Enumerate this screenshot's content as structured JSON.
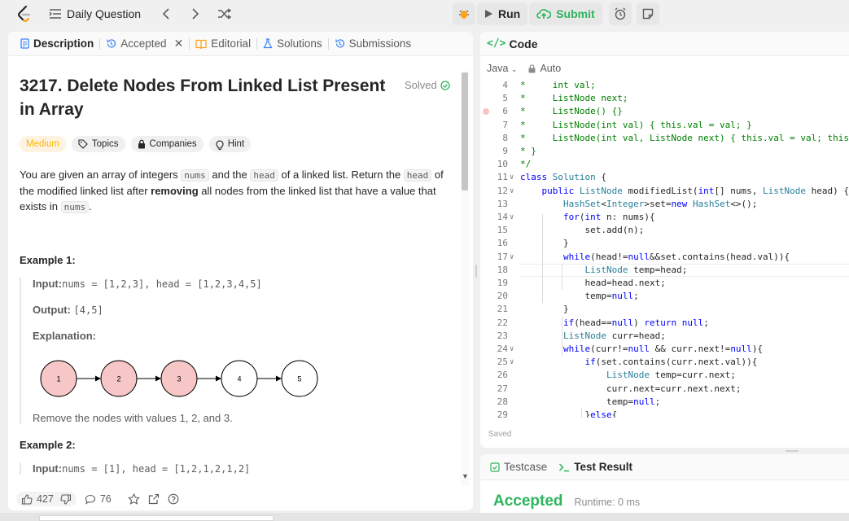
{
  "topbar": {
    "title": "Daily Question",
    "run_label": "Run",
    "submit_label": "Submit"
  },
  "left_tabs": [
    {
      "label": "Description"
    },
    {
      "label": "Accepted"
    },
    {
      "label": "Editorial"
    },
    {
      "label": "Solutions"
    },
    {
      "label": "Submissions"
    }
  ],
  "problem": {
    "title": "3217. Delete Nodes From Linked List Present in Array",
    "status": "Solved",
    "difficulty": "Medium",
    "chips": [
      "Topics",
      "Companies",
      "Hint"
    ],
    "desc_p1": "You are given an array of integers ",
    "desc_code1": "nums",
    "desc_p2": " and the ",
    "desc_code2": "head",
    "desc_p3": " of a linked list. Return the ",
    "desc_code3": "head",
    "desc_p4": " of the modified linked list after ",
    "desc_bold": "removing",
    "desc_p5": " all nodes from the linked list that have a value that exists in ",
    "desc_code4": "nums",
    "desc_p6": ".",
    "example1": {
      "heading": "Example 1:",
      "input_label": "Input:",
      "input_value": "nums = [1,2,3], head = [1,2,3,4,5]",
      "output_label": "Output:",
      "output_value": "[4,5]",
      "explanation_label": "Explanation:",
      "nodes": [
        {
          "value": "1",
          "removed": true
        },
        {
          "value": "2",
          "removed": true
        },
        {
          "value": "3",
          "removed": true
        },
        {
          "value": "4",
          "removed": false
        },
        {
          "value": "5",
          "removed": false
        }
      ],
      "note": "Remove the nodes with values 1, 2, and 3."
    },
    "example2": {
      "heading": "Example 2:",
      "input_label": "Input:",
      "input_value": "nums = [1], head = [1,2,1,2,1,2]"
    }
  },
  "bottom_bar": {
    "likes": "427",
    "comments": "76"
  },
  "code": {
    "tab_label": "Code",
    "tab_icon": "</>",
    "language": "Java",
    "mode": "Auto",
    "saved": "Saved",
    "lines": [
      {
        "n": "4",
        "fold": "",
        "tokens": [
          [
            "c",
            "*     int val;"
          ]
        ]
      },
      {
        "n": "5",
        "fold": "",
        "tokens": [
          [
            "c",
            "*     ListNode next;"
          ]
        ]
      },
      {
        "n": "6",
        "fold": "",
        "tokens": [
          [
            "c",
            "*     ListNode() {}"
          ]
        ]
      },
      {
        "n": "7",
        "fold": "",
        "tokens": [
          [
            "c",
            "*     ListNode(int val) { this.val = val; }"
          ]
        ]
      },
      {
        "n": "8",
        "fold": "",
        "tokens": [
          [
            "c",
            "*     ListNode(int val, ListNode next) { this.val = val; this.next = next; }"
          ]
        ]
      },
      {
        "n": "9",
        "fold": "",
        "tokens": [
          [
            "c",
            "* }"
          ]
        ]
      },
      {
        "n": "10",
        "fold": "",
        "tokens": [
          [
            "c",
            "*/"
          ]
        ]
      },
      {
        "n": "11",
        "fold": "v",
        "tokens": [
          [
            "k",
            "class "
          ],
          [
            "t",
            "Solution"
          ],
          [
            "p",
            " {"
          ]
        ]
      },
      {
        "n": "12",
        "fold": "v",
        "tokens": [
          [
            "p",
            "    "
          ],
          [
            "k",
            "public "
          ],
          [
            "t",
            "ListNode"
          ],
          [
            "p",
            " modifiedList("
          ],
          [
            "k",
            "int"
          ],
          [
            "p",
            "[] nums, "
          ],
          [
            "t",
            "ListNode"
          ],
          [
            "p",
            " head) {"
          ]
        ]
      },
      {
        "n": "13",
        "fold": "",
        "tokens": [
          [
            "p",
            "        "
          ],
          [
            "t",
            "HashSet"
          ],
          [
            "p",
            "<"
          ],
          [
            "t",
            "Integer"
          ],
          [
            "p",
            ">set="
          ],
          [
            "k",
            "new "
          ],
          [
            "t",
            "HashSet"
          ],
          [
            "p",
            "<>();"
          ]
        ]
      },
      {
        "n": "14",
        "fold": "v",
        "tokens": [
          [
            "p",
            "        "
          ],
          [
            "k",
            "for"
          ],
          [
            "p",
            "("
          ],
          [
            "k",
            "int"
          ],
          [
            "p",
            " n: nums){"
          ]
        ]
      },
      {
        "n": "15",
        "fold": "",
        "tokens": [
          [
            "p",
            "            set.add(n);"
          ]
        ]
      },
      {
        "n": "16",
        "fold": "",
        "tokens": [
          [
            "p",
            "        }"
          ]
        ]
      },
      {
        "n": "17",
        "fold": "v",
        "tokens": [
          [
            "p",
            "        "
          ],
          [
            "k",
            "while"
          ],
          [
            "p",
            "(head!="
          ],
          [
            "k",
            "null"
          ],
          [
            "p",
            "&&set.contains(head.val)){"
          ]
        ]
      },
      {
        "n": "18",
        "fold": "",
        "tokens": [
          [
            "p",
            "            "
          ],
          [
            "t",
            "ListNode"
          ],
          [
            "p",
            " temp=head;"
          ]
        ]
      },
      {
        "n": "19",
        "fold": "",
        "tokens": [
          [
            "p",
            "            head=head.next;"
          ]
        ]
      },
      {
        "n": "20",
        "fold": "",
        "tokens": [
          [
            "p",
            "            temp="
          ],
          [
            "k",
            "null"
          ],
          [
            "p",
            ";"
          ]
        ]
      },
      {
        "n": "21",
        "fold": "",
        "tokens": [
          [
            "p",
            "        }"
          ]
        ]
      },
      {
        "n": "22",
        "fold": "",
        "tokens": [
          [
            "p",
            "        "
          ],
          [
            "k",
            "if"
          ],
          [
            "p",
            "(head=="
          ],
          [
            "k",
            "null"
          ],
          [
            "p",
            ") "
          ],
          [
            "k",
            "return null"
          ],
          [
            "p",
            ";"
          ]
        ]
      },
      {
        "n": "23",
        "fold": "",
        "tokens": [
          [
            "p",
            "        "
          ],
          [
            "t",
            "ListNode"
          ],
          [
            "p",
            " curr=head;"
          ]
        ]
      },
      {
        "n": "24",
        "fold": "v",
        "tokens": [
          [
            "p",
            "        "
          ],
          [
            "k",
            "while"
          ],
          [
            "p",
            "(curr!="
          ],
          [
            "k",
            "null"
          ],
          [
            "p",
            " && curr.next!="
          ],
          [
            "k",
            "null"
          ],
          [
            "p",
            "){"
          ]
        ]
      },
      {
        "n": "25",
        "fold": "v",
        "tokens": [
          [
            "p",
            "            "
          ],
          [
            "k",
            "if"
          ],
          [
            "p",
            "(set.contains(curr.next.val)){"
          ]
        ]
      },
      {
        "n": "26",
        "fold": "",
        "tokens": [
          [
            "p",
            "                "
          ],
          [
            "t",
            "ListNode"
          ],
          [
            "p",
            " temp=curr.next;"
          ]
        ]
      },
      {
        "n": "27",
        "fold": "",
        "tokens": [
          [
            "p",
            "                curr.next=curr.next.next;"
          ]
        ]
      },
      {
        "n": "28",
        "fold": "",
        "tokens": [
          [
            "p",
            "                temp="
          ],
          [
            "k",
            "null"
          ],
          [
            "p",
            ";"
          ]
        ]
      },
      {
        "n": "29",
        "fold": "",
        "tokens": [
          [
            "p",
            "            }"
          ],
          [
            "k",
            "else"
          ],
          [
            "p",
            "{"
          ]
        ]
      }
    ]
  },
  "result": {
    "testcase_label": "Testcase",
    "test_result_label": "Test Result",
    "status": "Accepted",
    "runtime": "Runtime: 0 ms"
  },
  "colors": {
    "accent_green": "#2db55d",
    "medium": "#ffb800",
    "removed_node": "#f7c6c6"
  }
}
